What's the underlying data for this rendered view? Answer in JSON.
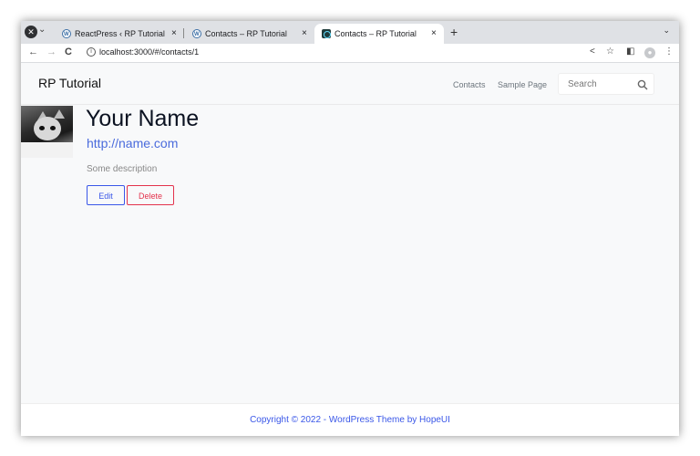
{
  "browser": {
    "tabs": [
      {
        "title": "ReactPress ‹ RP Tutorial — ",
        "favicon": "wordpress-icon",
        "active": false
      },
      {
        "title": "Contacts – RP Tutorial",
        "favicon": "wordpress-icon",
        "active": false
      },
      {
        "title": "Contacts – RP Tutorial",
        "favicon": "react-icon",
        "active": true
      }
    ],
    "close_glyph": "×",
    "new_tab_glyph": "+",
    "url": "localhost:3000/#/contacts/1"
  },
  "site": {
    "brand": "RP Tutorial",
    "nav": [
      "Contacts",
      "Sample Page"
    ],
    "search_placeholder": "Search"
  },
  "contact": {
    "name": "Your Name",
    "website": "http://name.com",
    "description": "Some description",
    "edit_label": "Edit",
    "delete_label": "Delete"
  },
  "footer": {
    "text": "Copyright © 2022 - WordPress Theme by HopeUI"
  },
  "colors": {
    "primary": "#3a57e8",
    "danger": "#e3324c",
    "link": "#4a6bdc"
  }
}
